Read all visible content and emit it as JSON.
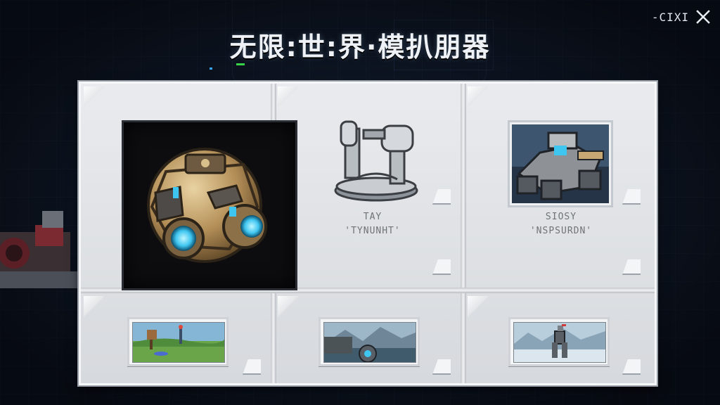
{
  "header": {
    "title": "无限:世:界·模扒朋器",
    "top_right_code": "-CIXI"
  },
  "items": [
    {
      "icon": "armored-sphere-icon",
      "selected": true
    },
    {
      "icon": "turret-icon",
      "label_line1": "TAY",
      "label_line2": "'TYNUNHT'"
    },
    {
      "icon": "tank-mech-icon",
      "label_line1": "SIOSY",
      "label_line2": "'NSPSURDN'"
    }
  ],
  "thumbnails": [
    {
      "scene": "grassland-scene-icon"
    },
    {
      "scene": "mountain-lake-scene-icon"
    },
    {
      "scene": "icy-robot-scene-icon"
    }
  ],
  "colors": {
    "accent_blue": "#3aa6ff",
    "accent_green": "#39d34a",
    "panel": "#e3e5e8",
    "background": "#0f1624"
  }
}
